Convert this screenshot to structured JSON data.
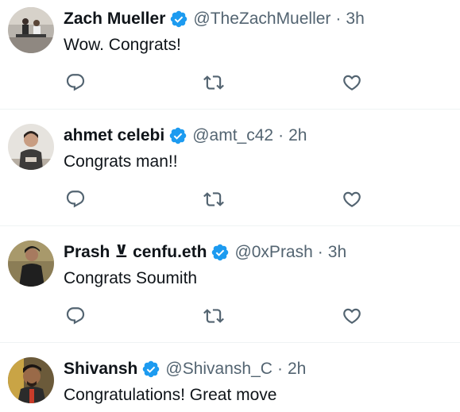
{
  "colors": {
    "text": "#0f1419",
    "muted": "#536471",
    "verified": "#1d9bf0",
    "divider": "#eff3f4"
  },
  "replies": [
    {
      "name": "Zach Mueller",
      "handle": "@TheZachMueller",
      "separator": "·",
      "time": "3h",
      "text": "Wow. Congrats!",
      "verified": true,
      "icons": [
        "reply-icon",
        "repost-icon",
        "like-icon"
      ]
    },
    {
      "name": "ahmet celebi",
      "handle": "@amt_c42",
      "separator": "·",
      "time": "2h",
      "text": "Congrats man!!",
      "verified": true,
      "icons": [
        "reply-icon",
        "repost-icon",
        "like-icon"
      ]
    },
    {
      "name": "Prash ⊻ cenfu.eth",
      "handle": "@0xPrash",
      "separator": "·",
      "time": "3h",
      "text": "Congrats Soumith",
      "verified": true,
      "icons": [
        "reply-icon",
        "repost-icon",
        "like-icon"
      ]
    },
    {
      "name": "Shivansh",
      "handle": "@Shivansh_C",
      "separator": "·",
      "time": "2h",
      "text": "Congratulations! Great move",
      "verified": true,
      "icons": []
    }
  ]
}
